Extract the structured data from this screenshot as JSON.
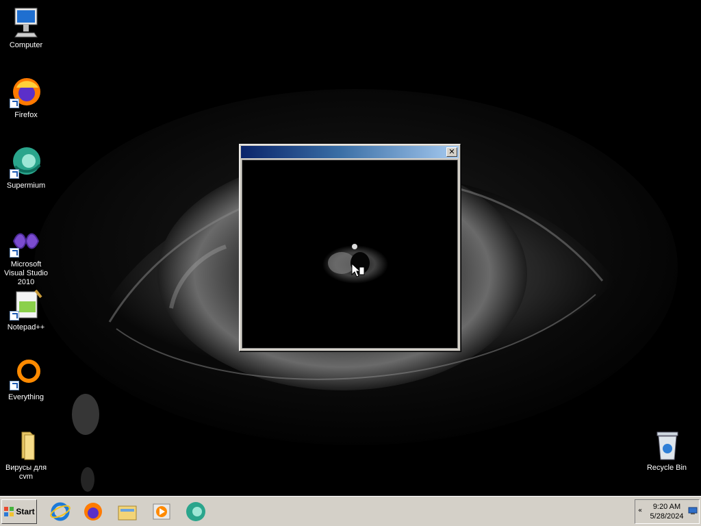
{
  "desktop": {
    "icons": [
      {
        "label": "Computer",
        "icon": "computer-icon"
      },
      {
        "label": "Firefox",
        "icon": "firefox-icon"
      },
      {
        "label": "Supermium",
        "icon": "supermium-icon"
      },
      {
        "label": "Microsoft Visual Studio 2010",
        "icon": "visual-studio-icon"
      },
      {
        "label": "Notepad++",
        "icon": "notepadpp-icon"
      },
      {
        "label": "Everything",
        "icon": "everything-icon"
      },
      {
        "label": "Вирусы для cvm",
        "icon": "folder-icon"
      },
      {
        "label": "Recycle Bin",
        "icon": "recycle-bin-icon"
      }
    ]
  },
  "popup": {
    "title": "",
    "close_label": "✕"
  },
  "taskbar": {
    "start_label": "Start",
    "quick_launch": [
      "internet-explorer-icon",
      "firefox-icon",
      "explorer-icon",
      "media-player-icon",
      "supermium-icon"
    ],
    "tray": {
      "time": "9:20 AM",
      "date": "5/28/2024",
      "expand_glyph": "«"
    }
  },
  "colors": {
    "taskbar_bg": "#d4d0c8",
    "title_active_start": "#0a246a",
    "title_active_end": "#a6caf0",
    "desktop_bg": "#000000"
  }
}
